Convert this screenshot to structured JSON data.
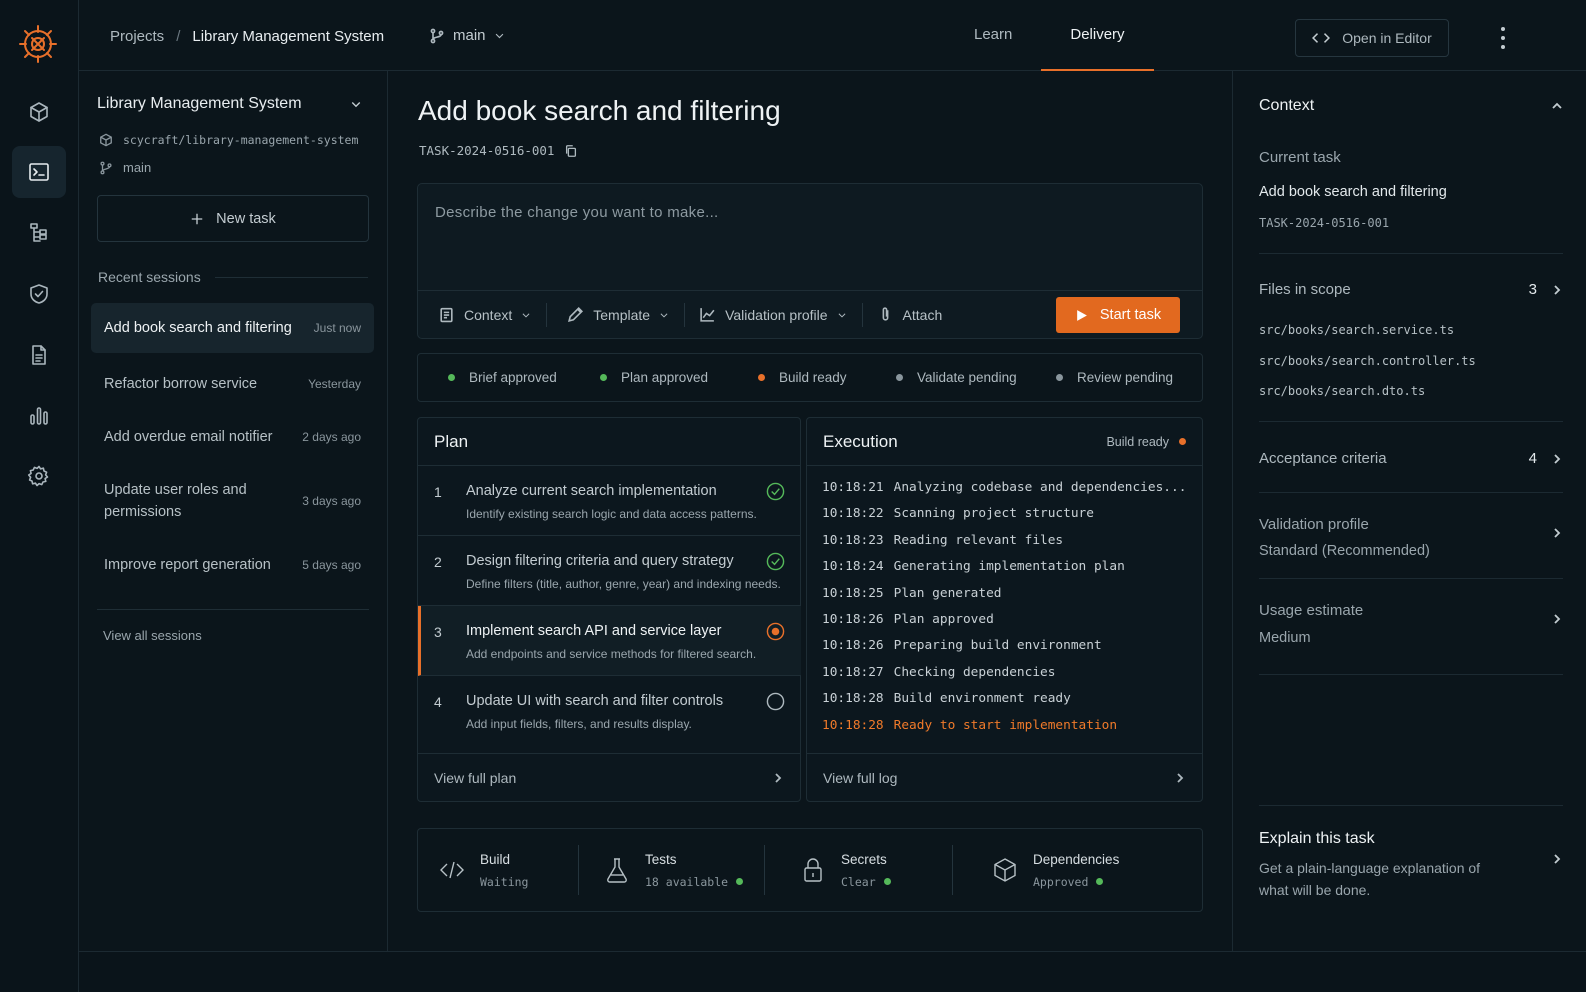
{
  "colors": {
    "accent": "#e8702a",
    "success": "#55b95a",
    "pending": "#8a969d",
    "background": "#0b151b"
  },
  "rail": {
    "items": [
      "cube-icon",
      "terminal-icon",
      "flow-icon",
      "shield-icon",
      "document-icon",
      "chart-icon",
      "gear-icon"
    ],
    "active": "terminal-icon"
  },
  "topbar": {
    "breadcrumb": {
      "projects": "Projects",
      "separator": "/",
      "project": "Library Management System"
    },
    "branch": "main",
    "tabs": [
      {
        "label": "Learn"
      },
      {
        "label": "Delivery"
      }
    ],
    "active_tab": "Delivery",
    "open_editor": "Open in Editor"
  },
  "sidebar": {
    "project": "Library Management System",
    "repo": "scycraft/library-management-system",
    "branch": "main",
    "new_task": "New task",
    "recent_label": "Recent sessions",
    "sessions": [
      {
        "title": "Add book search and filtering",
        "when": "Just now"
      },
      {
        "title": "Refactor borrow service",
        "when": "Yesterday"
      },
      {
        "title": "Add overdue email notifier",
        "when": "2 days ago"
      },
      {
        "title": "Update user roles and permissions",
        "when": "3 days ago"
      },
      {
        "title": "Improve report generation",
        "when": "5 days ago"
      }
    ],
    "view_all": "View all sessions"
  },
  "task": {
    "title": "Add book search and filtering",
    "id": "TASK-2024-0516-001",
    "prompt_placeholder": "Describe the change you want to make...",
    "tools": {
      "context": "Context",
      "template": "Template",
      "validation": "Validation profile",
      "attach": "Attach"
    },
    "start": "Start task",
    "status": [
      {
        "label": "Brief approved",
        "state": "done",
        "color": "#55b95a"
      },
      {
        "label": "Plan approved",
        "state": "done",
        "color": "#55b95a"
      },
      {
        "label": "Build ready",
        "state": "active",
        "color": "#e8702a"
      },
      {
        "label": "Validate pending",
        "state": "pending",
        "color": "#8a969d"
      },
      {
        "label": "Review pending",
        "state": "pending",
        "color": "#8a969d"
      }
    ]
  },
  "plan": {
    "title": "Plan",
    "steps": [
      {
        "n": "1",
        "title": "Analyze current search implementation",
        "desc": "Identify existing search logic and data access patterns.",
        "state": "done"
      },
      {
        "n": "2",
        "title": "Design filtering criteria and query strategy",
        "desc": "Define filters (title, author, genre, year) and indexing needs.",
        "state": "done"
      },
      {
        "n": "3",
        "title": "Implement search API and service layer",
        "desc": "Add endpoints and service methods for filtered search.",
        "state": "active"
      },
      {
        "n": "4",
        "title": "Update UI with search and filter controls",
        "desc": "Add input fields, filters, and results display.",
        "state": "todo"
      }
    ],
    "view_full": "View full plan"
  },
  "execution": {
    "title": "Execution",
    "badge": "Build ready",
    "logs": [
      {
        "time": "10:18:21",
        "msg": "Analyzing codebase and dependencies..."
      },
      {
        "time": "10:18:22",
        "msg": "Scanning project structure"
      },
      {
        "time": "10:18:23",
        "msg": "Reading relevant files"
      },
      {
        "time": "10:18:24",
        "msg": "Generating implementation plan"
      },
      {
        "time": "10:18:25",
        "msg": "Plan generated"
      },
      {
        "time": "10:18:26",
        "msg": "Plan approved"
      },
      {
        "time": "10:18:26",
        "msg": "Preparing build environment"
      },
      {
        "time": "10:18:27",
        "msg": "Checking dependencies"
      },
      {
        "time": "10:18:28",
        "msg": "Build environment ready"
      },
      {
        "time": "10:18:28",
        "msg": "Ready to start implementation"
      }
    ],
    "view_full": "View full log"
  },
  "chips": [
    {
      "icon": "code-icon",
      "label": "Build",
      "sub": "Waiting",
      "dot": false
    },
    {
      "icon": "flask-icon",
      "label": "Tests",
      "sub": "18 available",
      "dot": true
    },
    {
      "icon": "lock-icon",
      "label": "Secrets",
      "sub": "Clear",
      "dot": true
    },
    {
      "icon": "package-icon",
      "label": "Dependencies",
      "sub": "Approved",
      "dot": true
    }
  ],
  "context": {
    "title": "Context",
    "current_task_label": "Current task",
    "current_task": "Add book search and filtering",
    "current_task_id": "TASK-2024-0516-001",
    "files_label": "Files in scope",
    "files_count": "3",
    "files": [
      "src/books/search.service.ts",
      "src/books/search.controller.ts",
      "src/books/search.dto.ts"
    ],
    "acceptance_label": "Acceptance criteria",
    "acceptance_count": "4",
    "validation_label": "Validation profile",
    "validation_value": "Standard (Recommended)",
    "usage_label": "Usage estimate",
    "usage_value": "Medium",
    "explain_title": "Explain this task",
    "explain_desc": "Get a plain-language explanation of what will be done."
  }
}
